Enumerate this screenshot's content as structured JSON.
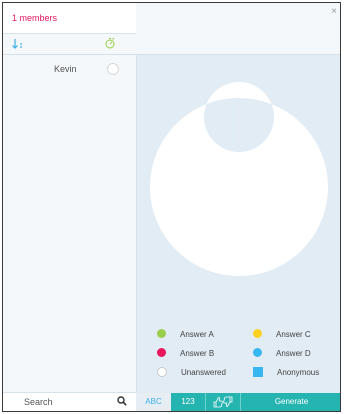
{
  "sidebar": {
    "members_label": "1 members",
    "member_list": [
      {
        "name": "Kevin"
      }
    ],
    "search_placeholder": "Search"
  },
  "chart_data": {
    "type": "pie",
    "donut": true,
    "categories": [
      "Answer A",
      "Answer B",
      "Unanswered",
      "Answer C",
      "Answer D",
      "Anonymous"
    ],
    "values": [
      0,
      0,
      1,
      0,
      0,
      0
    ]
  },
  "legend": {
    "items": [
      {
        "label": "Answer A",
        "color": "#9acd4a",
        "shape": "circle"
      },
      {
        "label": "Answer C",
        "color": "#ffd11f",
        "shape": "circle"
      },
      {
        "label": "Answer B",
        "color": "#e8175d",
        "shape": "circle"
      },
      {
        "label": "Answer D",
        "color": "#36b7ef",
        "shape": "circle"
      },
      {
        "label": "Unanswered",
        "color": "#ffffff",
        "shape": "circle"
      },
      {
        "label": "Anonymous",
        "color": "#36b7ef",
        "shape": "square"
      }
    ]
  },
  "toolbar": {
    "abc_label": "ABC",
    "num_label": "123",
    "thumbs_icon": "thumbs-up-down-icon",
    "generate_label": "Generate"
  },
  "colors": {
    "accent_pink": "#e2175e",
    "accent_blue": "#3ab0e8",
    "teal": "#26b4b1",
    "panel": "#e2ecf4"
  }
}
